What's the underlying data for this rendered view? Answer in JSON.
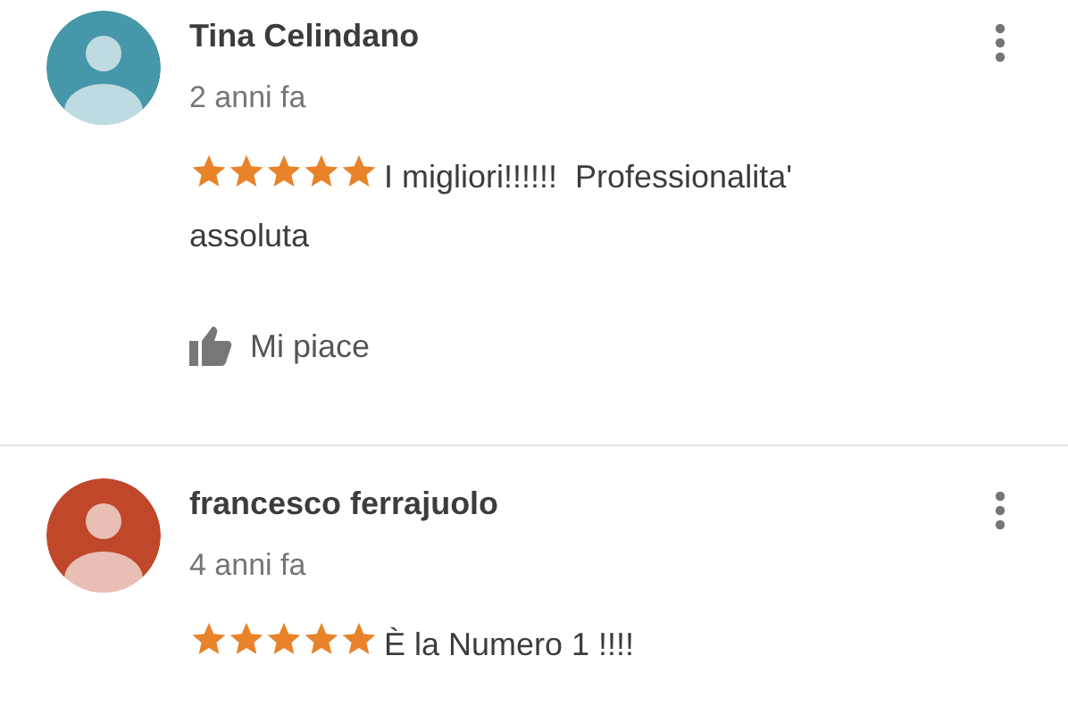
{
  "reviews": [
    {
      "color": "#4597a9",
      "name": "Tina Celindano",
      "date": "2 anni fa",
      "stars": 5,
      "text": "I migliori!!!!!!  Professionalita' assoluta",
      "like_label": "Mi piace"
    },
    {
      "color": "#c0472a",
      "name": "francesco ferrajuolo",
      "date": "4 anni fa",
      "stars": 5,
      "text": "È la Numero 1 !!!!"
    }
  ]
}
